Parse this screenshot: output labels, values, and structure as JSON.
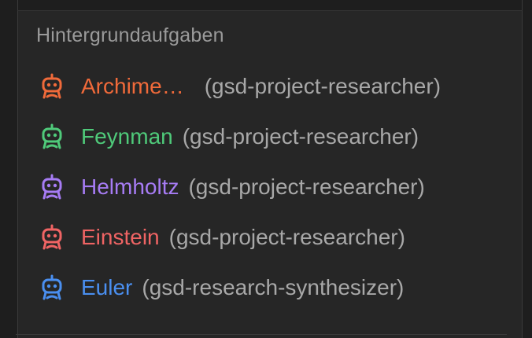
{
  "panel": {
    "title": "Hintergrundaufgaben"
  },
  "tasks": [
    {
      "name": "Archime…",
      "role": "(gsd-project-researcher)",
      "color": "#f06a3a",
      "icon": "robot-icon"
    },
    {
      "name": "Feynman",
      "role": "(gsd-project-researcher)",
      "color": "#4fca7a",
      "icon": "robot-icon"
    },
    {
      "name": "Helmholtz",
      "role": "(gsd-project-researcher)",
      "color": "#a77cf5",
      "icon": "robot-icon"
    },
    {
      "name": "Einstein",
      "role": "(gsd-project-researcher)",
      "color": "#f06464",
      "icon": "robot-icon"
    },
    {
      "name": "Euler",
      "role": "(gsd-research-synthesizer)",
      "color": "#4a8ff0",
      "icon": "robot-icon"
    }
  ]
}
